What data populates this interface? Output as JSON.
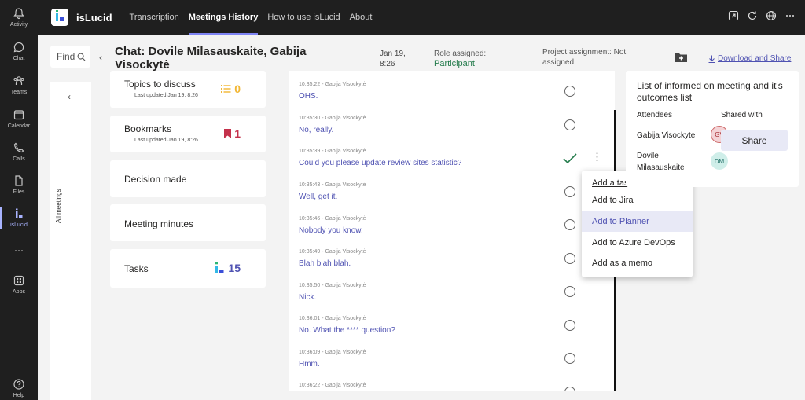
{
  "rail": {
    "items": [
      {
        "label": "Activity",
        "icon": "bell-icon"
      },
      {
        "label": "Chat",
        "icon": "chat-icon"
      },
      {
        "label": "Teams",
        "icon": "teams-icon"
      },
      {
        "label": "Calendar",
        "icon": "calendar-icon"
      },
      {
        "label": "Calls",
        "icon": "phone-icon"
      },
      {
        "label": "Files",
        "icon": "file-icon"
      },
      {
        "label": "isLucid",
        "icon": "islucid-icon"
      },
      {
        "label": "···",
        "icon": "more-icon"
      },
      {
        "label": "Apps",
        "icon": "apps-icon"
      },
      {
        "label": "Help",
        "icon": "help-icon"
      }
    ]
  },
  "topbar": {
    "app_title": "isLucid",
    "nav": [
      "Transcription",
      "Meetings History",
      "How to use isLucid",
      "About"
    ],
    "active_nav": "Meetings History"
  },
  "header": {
    "find_label": "Find",
    "back_chevron": "‹",
    "chat_title": "Chat: Dovile Milasauskaite, Gabija Visockytė",
    "date_line1": "Jan 19,",
    "date_line2": "8:26",
    "role_label": "Role assigned:",
    "role_value": "Participant",
    "project_label": "Project assignment: Not assigned",
    "download_label": "Download and Share"
  },
  "side_panel": {
    "chevron": "‹",
    "label": "All meetings"
  },
  "cards": {
    "topics": {
      "title": "Topics to discuss",
      "sub": "Last updated Jan 19, 8:26",
      "count": "0"
    },
    "bookmarks": {
      "title": "Bookmarks",
      "sub": "Last updated Jan 19, 8:26",
      "count": "1"
    },
    "decision": {
      "title": "Decision made"
    },
    "minutes": {
      "title": "Meeting minutes"
    },
    "tasks": {
      "title": "Tasks",
      "count": "15"
    }
  },
  "messages": [
    {
      "meta": "10:35:22 - Gabija Visockytė",
      "text": "OHS."
    },
    {
      "meta": "10:35:30 - Gabija Visockytė",
      "text": "No, really."
    },
    {
      "meta": "10:35:39 - Gabija Visockytė",
      "text": "Could you please update review sites statistic?"
    },
    {
      "meta": "10:35:43 - Gabija Visockytė",
      "text": "Well, get it."
    },
    {
      "meta": "10:35:46 - Gabija Visockytė",
      "text": "Nobody you know."
    },
    {
      "meta": "10:35:49 - Gabija Visockytė",
      "text": "Blah blah blah."
    },
    {
      "meta": "10:35:50 - Gabija Visockytė",
      "text": "Nick."
    },
    {
      "meta": "10:36:01 - Gabija Visockytė",
      "text": "No. What the **** question?"
    },
    {
      "meta": "10:36:09 - Gabija Visockytė",
      "text": "Hmm."
    },
    {
      "meta": "10:36:22 - Gabija Visockytė",
      "text": ""
    }
  ],
  "menu": {
    "header": "Add a task:",
    "items": [
      "Add to Jira",
      "Add to Planner",
      "Add to Azure DevOps",
      "Add as a memo"
    ],
    "highlighted": "Add to Planner"
  },
  "informed": {
    "title": "List of informed on meeting and it's outcomes list",
    "attendees_header": "Attendees",
    "shared_header": "Shared with",
    "attendees": [
      {
        "name": "Gabija Visockytė",
        "initials": "GV"
      },
      {
        "name": "Dovile Milasauskaite",
        "initials": "DM"
      }
    ],
    "share_label": "Share"
  },
  "colors": {
    "accent": "#4f52b2",
    "participant_green": "#237b4b",
    "topics_yellow": "#f2b632",
    "bookmark_red": "#c4314b",
    "check_green": "#237b4b"
  }
}
